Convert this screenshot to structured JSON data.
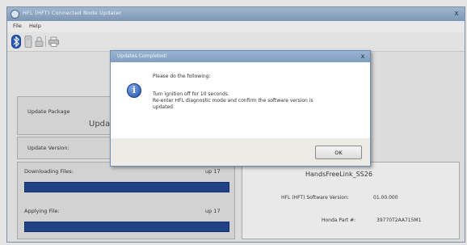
{
  "window": {
    "title": "HFL (HFT) Connected Node Updater",
    "close_glyph": "x"
  },
  "menu": {
    "items": [
      "File",
      "Help"
    ]
  },
  "toolbar": {
    "icons": [
      "bluetooth-icon",
      "phone-icon",
      "lock-icon",
      "printer-icon"
    ]
  },
  "left_panel": {
    "update_package_label": "Update Package",
    "update_heading": "Upda",
    "update_version_label": "Update Version:",
    "downloading_label": "Downloading Files:",
    "downloading_count": "up 17",
    "applying_label": "Applying File:",
    "applying_count": "up 17"
  },
  "right_panel": {
    "device_name": "HandsFreeLink_SS26",
    "software_version_label": "HFL (HFT) Software Version:",
    "software_version_value": "01.00.000",
    "part_label": "Honda Part #:",
    "part_value": "39770T2AA715M1"
  },
  "dialog": {
    "title": "Updates Completed!",
    "close_glyph": "x",
    "line1": "Please do the following:",
    "line2": "Turn ignition off for 10 seconds.",
    "line3": "Re-enter HFL diagnostic mode and confirm the software version is",
    "line4": "updated.",
    "ok_label": "OK"
  },
  "colors": {
    "progress_fill": "#1f4384",
    "titlebar": "#8aa4c2"
  },
  "progress": {
    "downloading_fraction": 1.0,
    "applying_fraction": 1.0
  }
}
